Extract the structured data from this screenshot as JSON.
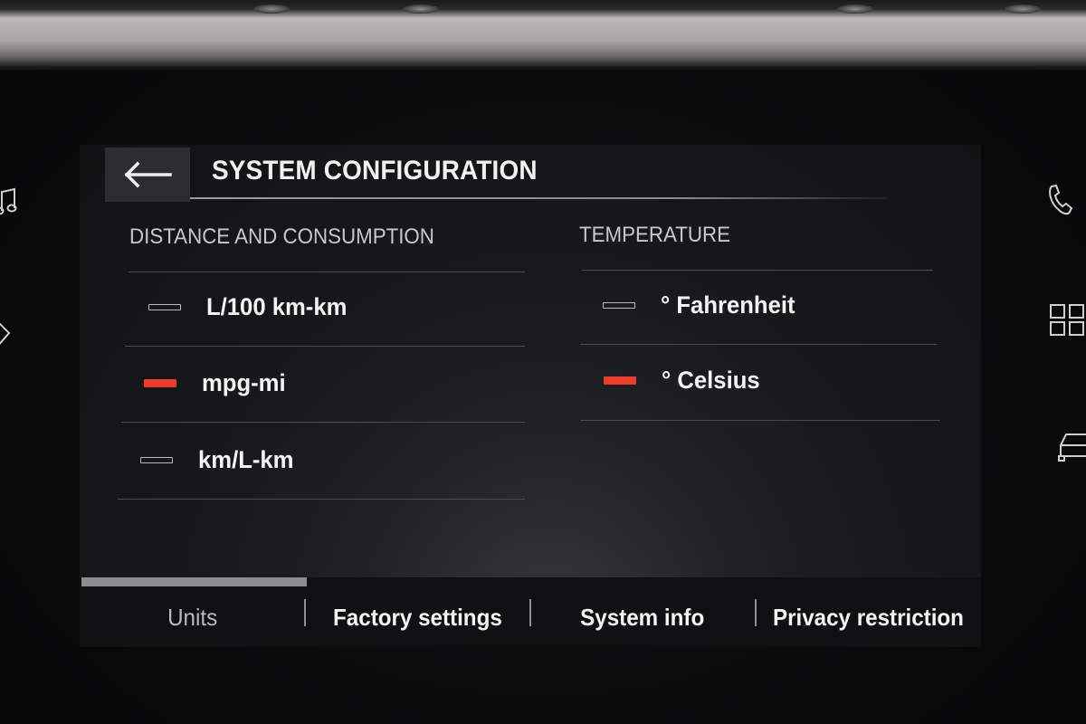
{
  "header": {
    "title": "SYSTEM CONFIGURATION",
    "back_icon": "arrow-left-icon"
  },
  "sections": {
    "distance": {
      "heading": "DISTANCE AND CONSUMPTION",
      "options": [
        {
          "label": "L/100 km-km",
          "selected": false
        },
        {
          "label": "mpg-mi",
          "selected": true
        },
        {
          "label": "km/L-km",
          "selected": false
        }
      ]
    },
    "temperature": {
      "heading": "TEMPERATURE",
      "options": [
        {
          "label": "° Fahrenheit",
          "selected": false
        },
        {
          "label": "° Celsius",
          "selected": true
        }
      ]
    }
  },
  "tabs": [
    {
      "label": "Units",
      "active": true
    },
    {
      "label": "Factory settings",
      "active": false
    },
    {
      "label": "System info",
      "active": false
    },
    {
      "label": "Privacy restriction",
      "active": false
    }
  ],
  "hardkeys": {
    "left": [
      "music-note-icon",
      "navigation-arrow-icon"
    ],
    "right": [
      "phone-icon",
      "apps-grid-icon",
      "car-icon"
    ]
  },
  "colors": {
    "accent": "#ee3b2b",
    "background": "#151719"
  }
}
